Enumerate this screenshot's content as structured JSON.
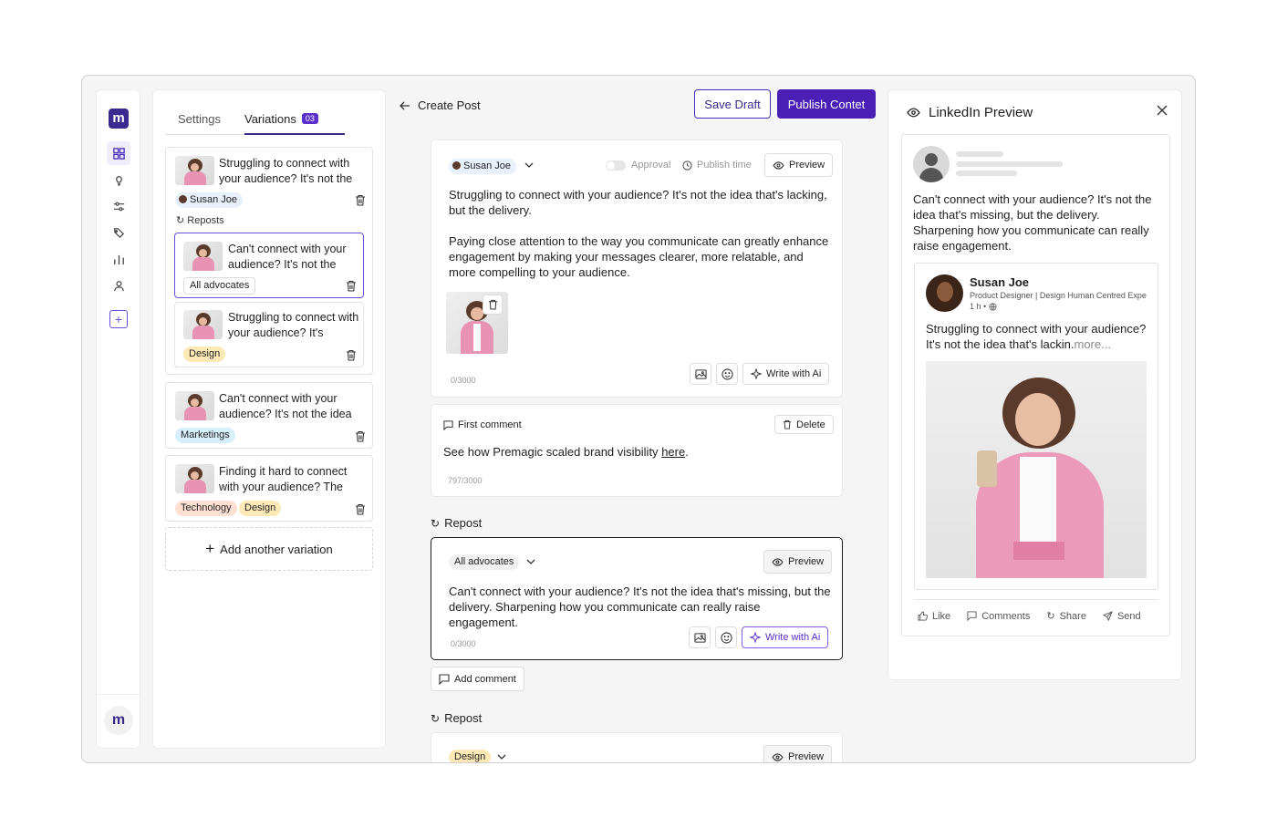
{
  "sidebar": {
    "logo": "m",
    "nav_icons": [
      "dashboard-icon",
      "lightbulb-icon",
      "sliders-icon",
      "tags-icon",
      "bar-chart-icon",
      "user-icon"
    ],
    "add": "+",
    "bottom_logo": "m"
  },
  "variations_panel": {
    "tabs": [
      {
        "label": "Settings"
      },
      {
        "label": "Variations",
        "count": "03"
      }
    ],
    "cards": [
      {
        "text": "Struggling to connect with your audience? It's not the",
        "chip": "Susan Joe",
        "reposts_label": "Reposts",
        "reposts": [
          {
            "text": "Can't connect with your audience? It's not the",
            "chip": "All advocates"
          },
          {
            "text": "Struggling to connect with your audience? It's",
            "chip": "Design"
          }
        ]
      },
      {
        "text": "Can't connect with your audience? It's not the idea",
        "chip": "Marketings"
      },
      {
        "text": "Finding it hard to connect with your audience? The",
        "chips": [
          "Technology",
          "Design"
        ]
      }
    ],
    "add_variation": "Add another variation"
  },
  "editor": {
    "back_label": "Create Post",
    "save_draft": "Save Draft",
    "publish": "Publish Contet",
    "post": {
      "author": "Susan Joe",
      "approval": "Approval",
      "publish_time": "Publish time",
      "preview": "Preview",
      "paragraph1": "Struggling to connect with your audience? It's not the idea that's lacking, but the delivery.",
      "paragraph2": "Paying close attention to the way you communicate can greatly enhance engagement by making your messages clearer, more relatable, and more compelling to your audience.",
      "counter": "0/3000",
      "write_ai": "Write with Ai"
    },
    "first_comment": {
      "label": "First comment",
      "delete": "Delete",
      "text": "See how Premagic scaled brand visibility",
      "link": "here",
      "suffix": ".",
      "counter": "797/3000"
    },
    "repost1": {
      "label": "Repost",
      "audience": "All advocates",
      "preview": "Preview",
      "text": "Can't connect with your audience? It's not the idea that's missing, but the delivery. Sharpening how you communicate can really raise engagement.",
      "counter": "0/3000",
      "write_ai": "Write with Ai",
      "add_comment": "Add comment"
    },
    "repost2": {
      "label": "Repost",
      "audience": "Design",
      "preview": "Preview"
    }
  },
  "linkedin_preview": {
    "title": "LinkedIn Preview",
    "repost_text": "Can't connect with your audience? It's not the idea that's missing, but the delivery. Sharpening how you communicate can really raise engagement.",
    "author": "Susan Joe",
    "headline": "Product Designer | Design Human Centred Expe",
    "time": "1 h •",
    "post_text": "Struggling to connect with your audience? It's not the idea that's lackin.",
    "more": "more...",
    "actions": [
      "Like",
      "Comments",
      "Share",
      "Send"
    ]
  },
  "colors": {
    "primary": "#4a1fb5",
    "accent": "#3a2a8f",
    "frame_bg": "#f5f5f5"
  }
}
